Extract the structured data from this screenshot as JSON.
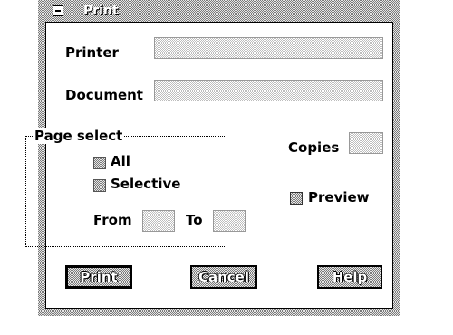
{
  "window": {
    "title": "Print"
  },
  "labels": {
    "printer": "Printer",
    "document": "Document",
    "page_select": "Page select",
    "all": "All",
    "selective": "Selective",
    "from": "From",
    "to": "To",
    "copies": "Copies",
    "preview": "Preview"
  },
  "fields": {
    "printer_value": "",
    "document_value": "",
    "from_value": "",
    "to_value": "",
    "copies_value": ""
  },
  "buttons": {
    "print": "Print",
    "cancel": "Cancel",
    "help": "Help"
  }
}
